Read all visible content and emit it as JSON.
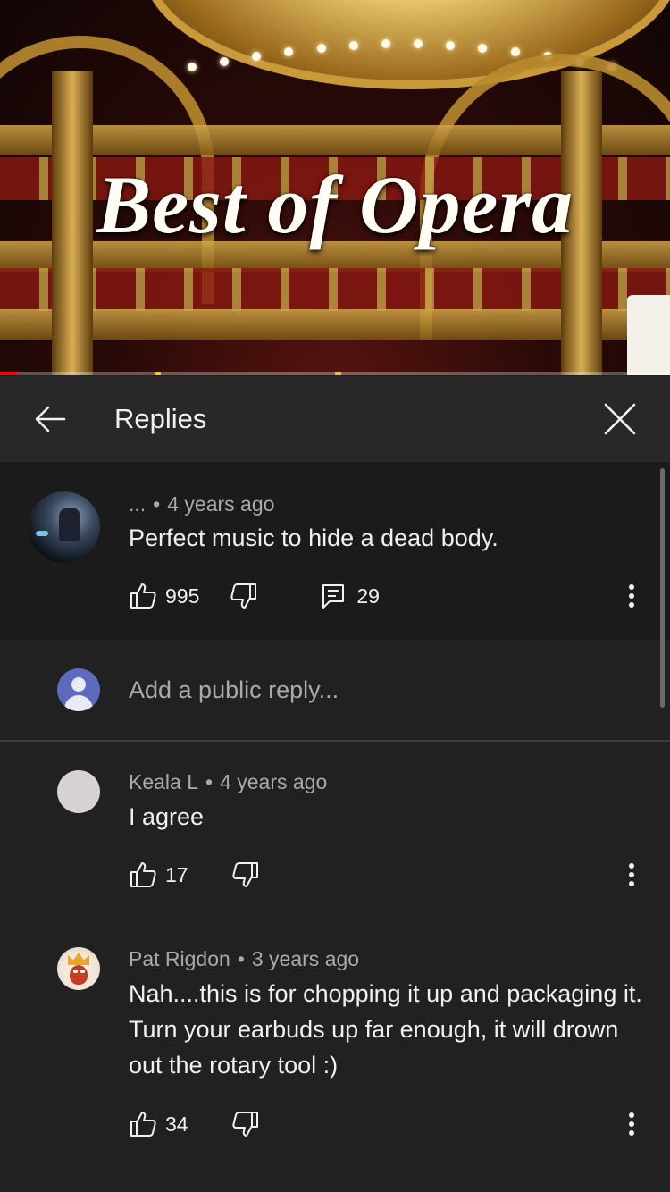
{
  "video": {
    "title_overlay": "Best of Opera",
    "progress_fraction": 0.026,
    "chapter_markers": [
      0.23,
      0.5
    ],
    "colors": {
      "played": "#ff0000",
      "marker": "#f2c12e"
    }
  },
  "panel": {
    "title": "Replies",
    "back_icon": "arrow-left-icon",
    "close_icon": "close-icon"
  },
  "parent_comment": {
    "author": "...",
    "separator": "•",
    "time": "4 years ago",
    "text": "Perfect music to hide a dead body.",
    "likes": "995",
    "reply_count": "29"
  },
  "add_reply": {
    "placeholder": "Add a public reply..."
  },
  "replies": [
    {
      "author": "Keala L",
      "separator": "•",
      "time": "4 years ago",
      "text": "I agree",
      "likes": "17"
    },
    {
      "author": "Pat Rigdon",
      "separator": "•",
      "time": "3 years ago",
      "text": "Nah....this is for chopping it up and packaging it. Turn your earbuds up far enough, it will drown out the rotary tool :)",
      "likes": "34"
    }
  ],
  "theme": {
    "background": "#212121",
    "header_bg": "#282828",
    "parent_bg": "#1b1b1b",
    "text_primary": "#f1f1f1",
    "text_secondary": "#aaaaaa",
    "accent_avatar": "#5c6bc0"
  }
}
